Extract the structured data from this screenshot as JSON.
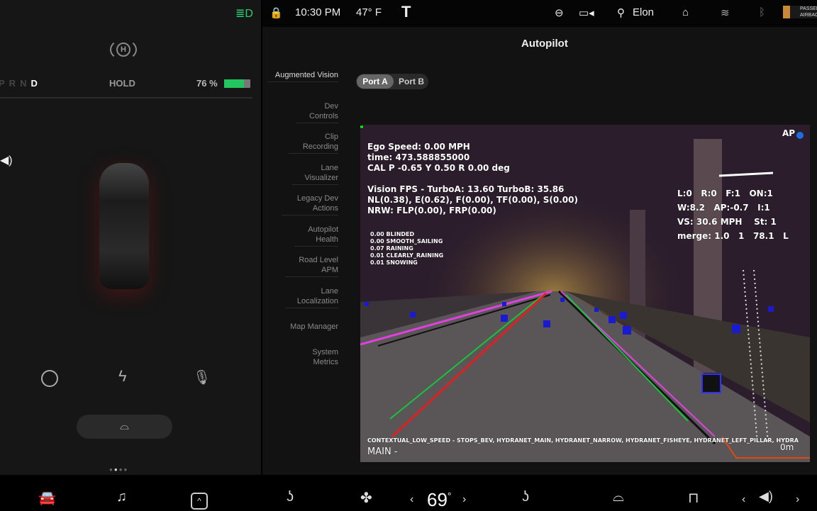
{
  "status": {
    "time": "10:30 PM",
    "temp": "47° F",
    "user": "Elon",
    "airbag": "PASSENGER AIRBAG"
  },
  "left": {
    "gears": [
      "P",
      "R",
      "N",
      "D"
    ],
    "hold": "HOLD",
    "battery": "76 %",
    "battery_level": 0.76
  },
  "page_title": "Autopilot",
  "menu": [
    {
      "label": "Augmented Vision",
      "active": true
    },
    {
      "label": "Dev Controls"
    },
    {
      "label": "Clip Recording"
    },
    {
      "label": "Lane Visualizer"
    },
    {
      "label": "Legacy Dev Actions"
    },
    {
      "label": "Autopilot Health"
    },
    {
      "label": "Road Level APM"
    },
    {
      "label": "Lane Localization"
    },
    {
      "label": "Map Manager"
    },
    {
      "label": "System Metrics"
    }
  ],
  "ports": [
    "Port A",
    "Port B"
  ],
  "overlay": {
    "info": "Ego Speed: 0.00 MPH\ntime: 473.588855000\nCAL P -0.65 Y 0.50 R 0.00 deg\n\nVision FPS - TurboA: 13.60 TurboB: 35.86\nNL(0.38), E(0.62), F(0.00), TF(0.00), S(0.00)\nNRW: FLP(0.00), FRP(0.00)",
    "weather": "0.00 BLINDED\n0.00 SMOOTH_SAILING\n0.07 RAINING\n0.01 CLEARLY_RAINING\n0.01 SNOWING",
    "ap": "AP",
    "lane": "L:0   R:0   F:1   ON:1\nW:8.2   AP:-0.7   I:1\nVS: 30.6 MPH    St: 1\nmerge: 1.0   1   78.1   L",
    "networks": "CONTEXTUAL_LOW_SPEED - STOPS_BEV, HYDRANET_MAIN, HYDRANET_NARROW, HYDRANET_FISHEYE, HYDRANET_LEFT_PILLAR, HYDRA",
    "camera": "MAIN -",
    "distance": "0m"
  },
  "climate": {
    "temp": "69",
    "deg": "°"
  },
  "colors": {
    "battery": "#22c55e",
    "green": "#19c23a",
    "red": "#e02020",
    "magenta": "#e040e0",
    "blue": "#1a1ad0"
  }
}
